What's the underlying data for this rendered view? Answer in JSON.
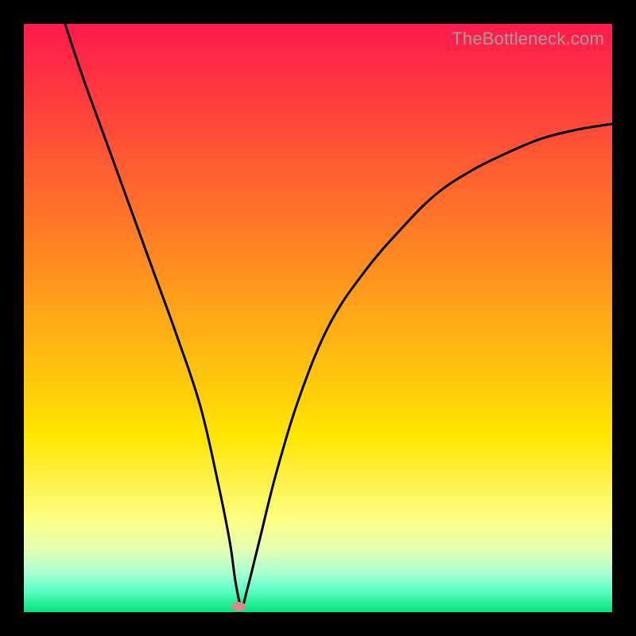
{
  "watermark": "TheBottleneck.com",
  "chart_data": {
    "type": "line",
    "title": "",
    "xlabel": "",
    "ylabel": "",
    "xlim": [
      0,
      100
    ],
    "ylim": [
      0,
      100
    ],
    "grid": false,
    "legend": false,
    "series": [
      {
        "name": "bottleneck-curve",
        "x": [
          7,
          10,
          14,
          18,
          22,
          26,
          30,
          33,
          35,
          36,
          37,
          38,
          40,
          43,
          47,
          52,
          58,
          64,
          70,
          76,
          82,
          88,
          94,
          100
        ],
        "values": [
          100,
          91,
          80,
          69,
          58,
          47,
          35,
          22,
          12,
          5,
          1,
          4,
          12,
          24,
          37,
          49,
          58,
          65,
          71,
          75,
          78,
          80.5,
          82,
          83
        ]
      }
    ],
    "annotations": [
      {
        "kind": "min-marker",
        "x": 36.5,
        "y": 1,
        "color": "#d88a8a"
      }
    ],
    "colors": {
      "curve": "#000000",
      "gradient_top": "#ff1a4d",
      "gradient_bottom": "#00e676",
      "background_frame": "#000000",
      "marker": "#d88a8a"
    }
  }
}
